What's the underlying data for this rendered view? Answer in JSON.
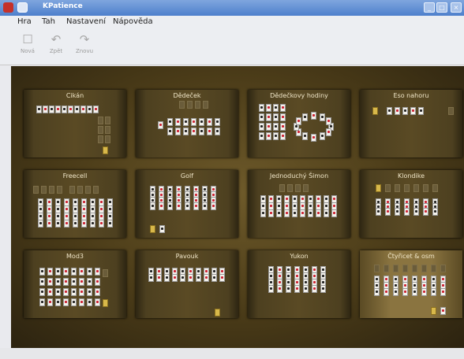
{
  "window": {
    "title": "KPatience"
  },
  "menu": [
    "Hra",
    "Tah",
    "Nastavení",
    "Nápověda"
  ],
  "toolbar": {
    "new": "Nová",
    "undo": "Zpět",
    "redo": "Znovu"
  },
  "games": [
    "Cikán",
    "Dědeček",
    "Dědečkovy hodiny",
    "Eso nahoru",
    "Freecell",
    "Golf",
    "Jednoduchý Šimon",
    "Klondike",
    "Mod3",
    "Pavouk",
    "Yukon",
    "Čtyřicet & osm"
  ],
  "selected_game": "Čtyřicet & osm"
}
